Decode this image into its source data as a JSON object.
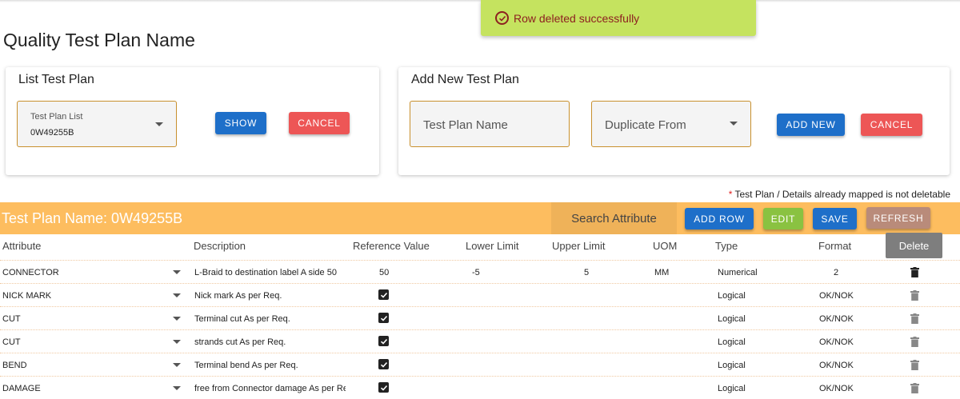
{
  "toast": {
    "message": "Row deleted successfully"
  },
  "page": {
    "title": "Quality Test Plan Name"
  },
  "list_card": {
    "title": "List Test Plan",
    "select_label": "Test Plan List",
    "select_value": "0W49255B",
    "show_label": "SHOW",
    "cancel_label": "CANCEL"
  },
  "add_card": {
    "title": "Add New Test Plan",
    "name_placeholder": "Test Plan Name",
    "duplicate_placeholder": "Duplicate From",
    "add_label": "ADD NEW",
    "cancel_label": "CANCEL"
  },
  "note": {
    "star": "*",
    "text": "Test Plan / Details already mapped is not deletable"
  },
  "toolbar": {
    "title": "Test Plan Name: 0W49255B",
    "search_label": "Search Attribute",
    "add_row_label": "ADD ROW",
    "edit_label": "EDIT",
    "save_label": "SAVE",
    "refresh_label": "REFRESH"
  },
  "tooltip": {
    "text": "Delete"
  },
  "columns": [
    "Attribute",
    "Description",
    "Reference Value",
    "Lower Limit",
    "Upper Limit",
    "UOM",
    "Type",
    "Format"
  ],
  "rows": [
    {
      "attribute": "CONNECTOR",
      "description": "L-Braid to destination label A side 50",
      "reference": "50",
      "lower": "-5",
      "upper": "5",
      "uom": "MM",
      "type": "Numerical",
      "format": "2",
      "checked": false
    },
    {
      "attribute": "NICK MARK",
      "description": "Nick mark As per Req.",
      "reference": "",
      "lower": "",
      "upper": "",
      "uom": "",
      "type": "Logical",
      "format": "OK/NOK",
      "checked": true
    },
    {
      "attribute": "CUT",
      "description": "Terminal cut As per Req.",
      "reference": "",
      "lower": "",
      "upper": "",
      "uom": "",
      "type": "Logical",
      "format": "OK/NOK",
      "checked": true
    },
    {
      "attribute": "CUT",
      "description": "strands cut As per Req.",
      "reference": "",
      "lower": "",
      "upper": "",
      "uom": "",
      "type": "Logical",
      "format": "OK/NOK",
      "checked": true
    },
    {
      "attribute": "BEND",
      "description": "Terminal bend As per Req.",
      "reference": "",
      "lower": "",
      "upper": "",
      "uom": "",
      "type": "Logical",
      "format": "OK/NOK",
      "checked": true
    },
    {
      "attribute": "DAMAGE",
      "description": "free from Connector damage As per Req.",
      "reference": "",
      "lower": "",
      "upper": "",
      "uom": "",
      "type": "Logical",
      "format": "OK/NOK",
      "checked": true
    }
  ],
  "colors": {
    "toast_bg": "#c5e35f",
    "bar_bg": "#fdbd5f",
    "primary": "#1e6fc9",
    "danger": "#ed5656",
    "edit": "#8ac241",
    "refresh": "#b98b7a"
  }
}
